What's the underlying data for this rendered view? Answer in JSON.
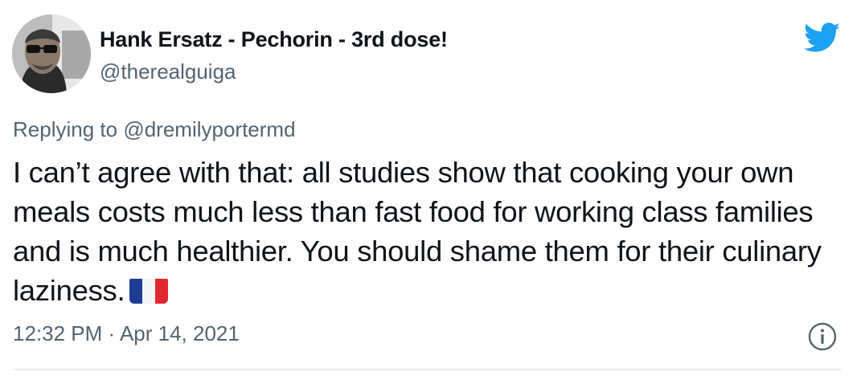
{
  "tweet": {
    "display_name": "Hank Ersatz - Pechorin - 3rd dose!",
    "handle": "@therealguiga",
    "replying_prefix": "Replying to ",
    "replying_to": "@dremilyportermd",
    "text": "I can’t agree with that: all studies show that cooking your own meals costs much less than fast food for working class families and is much healthier. You should shame them for their culinary laziness.",
    "flag_icon": "flag-france-icon",
    "timestamp": "12:32 PM · Apr 14, 2021"
  },
  "icons": {
    "brand": "twitter-bird-icon",
    "info": "info-icon"
  },
  "colors": {
    "twitter_blue": "#1da1f2",
    "text_primary": "#0f1419",
    "text_secondary": "#536471",
    "divider": "#e6ecf0"
  }
}
